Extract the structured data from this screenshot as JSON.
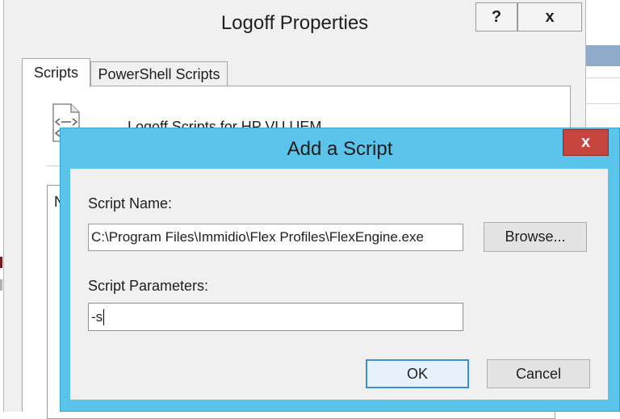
{
  "background_window": {
    "title": "Logoff Properties",
    "help_button": "?",
    "close_button": "x",
    "tabs": [
      {
        "label": "Scripts",
        "active": true
      },
      {
        "label": "PowerShell Scripts",
        "active": false
      }
    ],
    "heading": "Logoff Scripts for HP VU UEM",
    "list_column": "N"
  },
  "dialog": {
    "title": "Add a Script",
    "close_button": "x",
    "script_name_label": "Script Name:",
    "script_name_value": "C:\\Program Files\\Immidio\\Flex Profiles\\FlexEngine.exe",
    "browse_button": "Browse...",
    "script_params_label": "Script Parameters:",
    "script_params_value": "-s",
    "ok_button": "OK",
    "cancel_button": "Cancel"
  },
  "colors": {
    "dialog_frame": "#5bc4ea",
    "close_red": "#c6463f",
    "default_button_border": "#3c8fd6"
  }
}
